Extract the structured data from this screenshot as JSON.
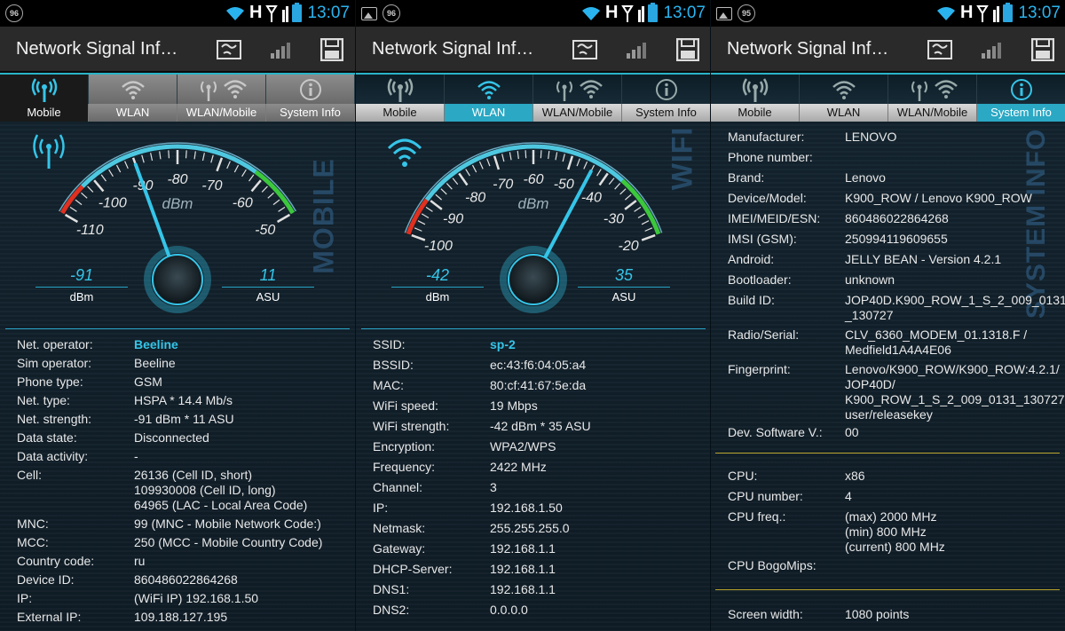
{
  "status_bar": {
    "time": "13:07",
    "network": "H",
    "badges": [
      "96",
      "96",
      "95"
    ]
  },
  "app": {
    "titles": [
      "Network Signal Inf…",
      "Network Signal Inf…",
      "Network Signal Inf…"
    ],
    "icons": [
      "map-icon",
      "signal-bars-icon",
      "save-icon"
    ]
  },
  "tabs": [
    "Mobile",
    "WLAN",
    "WLAN/Mobile",
    "System Info"
  ],
  "mobile": {
    "side_label": "MOBILE",
    "unit": "dBm",
    "ticks": [
      "-110",
      "-100",
      "-90",
      "-80",
      "-70",
      "-60",
      "-50"
    ],
    "dbm": "-91",
    "dbm_label": "dBm",
    "asu": "11",
    "asu_label": "ASU",
    "rows": [
      {
        "k": "Net. operator:",
        "v": "Beeline"
      },
      {
        "k": "Sim operator:",
        "v": "Beeline"
      },
      {
        "k": "Phone type:",
        "v": "GSM"
      },
      {
        "k": "Net. type:",
        "v": "HSPA * 14.4 Mb/s"
      },
      {
        "k": "Net. strength:",
        "v": "-91 dBm * 11 ASU"
      },
      {
        "k": "Data state:",
        "v": "Disconnected"
      },
      {
        "k": "Data activity:",
        "v": "-"
      },
      {
        "k": "Cell:",
        "v": "26136 (Cell ID, short)\n109930008 (Cell ID, long)\n64965 (LAC - Local Area Code)"
      },
      {
        "k": "MNC:",
        "v": "99 (MNC - Mobile Network Code:)"
      },
      {
        "k": "MCC:",
        "v": "250 (MCC - Mobile Country Code)"
      },
      {
        "k": "Country code:",
        "v": "ru"
      },
      {
        "k": "Device ID:",
        "v": "860486022864268"
      },
      {
        "k": "IP:",
        "v": "(WiFi IP) 192.168.1.50"
      },
      {
        "k": "External IP:",
        "v": "109.188.127.195"
      }
    ]
  },
  "wlan": {
    "side_label": "WIFI",
    "unit": "dBm",
    "ticks": [
      "-100",
      "-90",
      "-80",
      "-70",
      "-60",
      "-50",
      "-40",
      "-30",
      "-20"
    ],
    "dbm": "-42",
    "dbm_label": "dBm",
    "asu": "35",
    "asu_label": "ASU",
    "rows": [
      {
        "k": "SSID:",
        "v": "sp-2"
      },
      {
        "k": "BSSID:",
        "v": "ec:43:f6:04:05:a4"
      },
      {
        "k": "MAC:",
        "v": "80:cf:41:67:5e:da"
      },
      {
        "k": "WiFi speed:",
        "v": "19 Mbps"
      },
      {
        "k": "WiFi strength:",
        "v": "-42 dBm * 35 ASU"
      },
      {
        "k": "Encryption:",
        "v": "WPA2/WPS"
      },
      {
        "k": "Frequency:",
        "v": "2422 MHz"
      },
      {
        "k": "Channel:",
        "v": "3"
      },
      {
        "k": "IP:",
        "v": "192.168.1.50"
      },
      {
        "k": "Netmask:",
        "v": "255.255.255.0"
      },
      {
        "k": "Gateway:",
        "v": "192.168.1.1"
      },
      {
        "k": "DHCP-Server:",
        "v": "192.168.1.1"
      },
      {
        "k": "DNS1:",
        "v": "192.168.1.1"
      },
      {
        "k": "DNS2:",
        "v": "0.0.0.0"
      }
    ]
  },
  "sysinfo": {
    "side_label": "SYSTEM INFO",
    "rows": [
      {
        "k": "Manufacturer:",
        "v": "LENOVO"
      },
      {
        "k": "Phone number:",
        "v": ""
      },
      {
        "k": "Brand:",
        "v": "Lenovo"
      },
      {
        "k": "Device/Model:",
        "v": "K900_ROW / Lenovo K900_ROW"
      },
      {
        "k": "IMEI/MEID/ESN:",
        "v": "860486022864268"
      },
      {
        "k": "IMSI (GSM):",
        "v": "250994119609655"
      },
      {
        "k": "Android:",
        "v": "JELLY BEAN - Version 4.2.1"
      },
      {
        "k": "Bootloader:",
        "v": "unknown"
      },
      {
        "k": "Build ID:",
        "v": "JOP40D.K900_ROW_1_S_2_009_0131\n_130727"
      },
      {
        "k": "Radio/Serial:",
        "v": "CLV_6360_MODEM_01.1318.F /\nMedfield1A4A4E06"
      },
      {
        "k": "Fingerprint:",
        "v": "Lenovo/K900_ROW/K900_ROW:4.2.1/\nJOP40D/\nK900_ROW_1_S_2_009_0131_130727:\nuser/releasekey"
      },
      {
        "k": "Dev. Software V.:",
        "v": "00"
      }
    ],
    "cpu_rows": [
      {
        "k": "CPU:",
        "v": "x86"
      },
      {
        "k": "CPU number:",
        "v": "4"
      },
      {
        "k": "CPU freq.:",
        "v": "(max) 2000 MHz\n(min) 800 MHz\n(current) 800 MHz"
      },
      {
        "k": "CPU BogoMips:",
        "v": ""
      }
    ],
    "screen_rows": [
      {
        "k": "Screen width:",
        "v": "1080 points"
      }
    ]
  },
  "colors": {
    "accent": "#2aa8c4",
    "readout": "#35c5e8",
    "gauge_red": "#e03020",
    "gauge_green": "#3cc83c",
    "divider": "#b8a42a"
  }
}
